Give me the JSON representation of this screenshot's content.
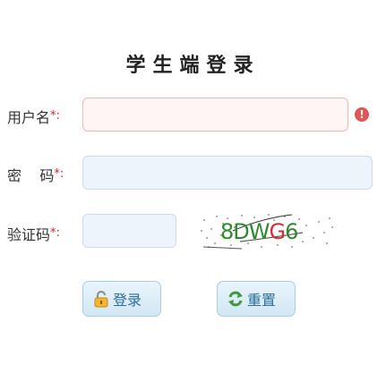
{
  "title": "学生端登录",
  "form": {
    "username": {
      "label": "用户名",
      "required_mark": "*:",
      "value": ""
    },
    "password": {
      "label": "密    码",
      "required_mark": "*:",
      "value": ""
    },
    "captcha": {
      "label": "验证码",
      "required_mark": "*:",
      "value": "",
      "image_text": "8DWG6"
    },
    "username_error_icon": "!"
  },
  "buttons": {
    "login": {
      "label": "登录",
      "icon": "lock-icon"
    },
    "reset": {
      "label": "重置",
      "icon": "refresh-icon"
    }
  },
  "colors": {
    "error": "#e05555",
    "button_text": "#2b6d9c",
    "input_bg": "#eef4fb"
  }
}
